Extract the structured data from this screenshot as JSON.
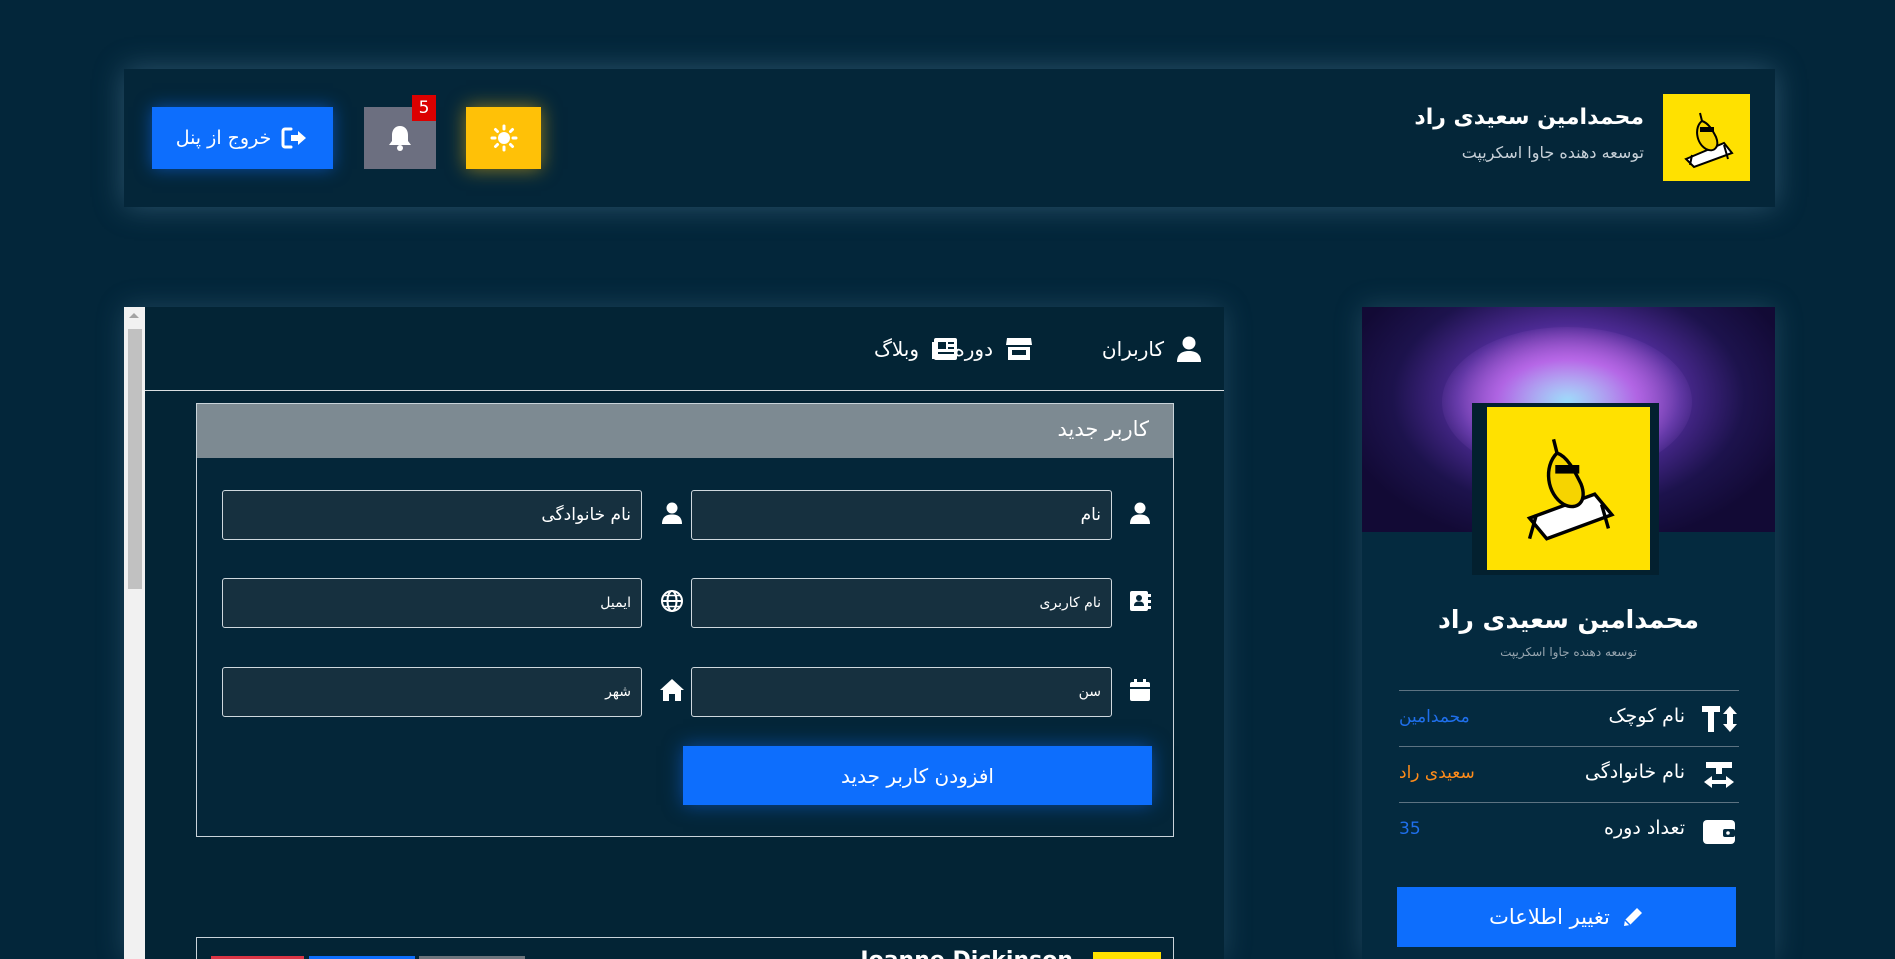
{
  "header": {
    "user_name": "محمدامین سعیدی راد",
    "user_role": "توسعه دهنده جاوا اسکریپت",
    "logout_label": "خروج از پنل",
    "notification_count": "5"
  },
  "nav": {
    "users": "کاربران",
    "courses": "دوره‌ها",
    "blog": "وبلاگ"
  },
  "new_user_form": {
    "title": "کاربر جدید",
    "first_name_value": "نام",
    "last_name_value": "نام خانوادگی",
    "username_value": "نام کاربری",
    "email_value": "ایمیل",
    "age_value": "سن",
    "city_value": "شهر",
    "submit_label": "افزودن کاربر جدید"
  },
  "user_list": {
    "first_user_name": "Joanne Dickinson"
  },
  "profile": {
    "name": "محمدامین سعیدی راد",
    "role": "توسعه دهنده جاوا اسکریپت",
    "rows": [
      {
        "label": "نام کوچک",
        "value": "محمدامین",
        "value_color": "#1f6feb"
      },
      {
        "label": "نام خانوادگی",
        "value": "سعیدی راد",
        "value_color": "#ff8c1a"
      },
      {
        "label": "تعداد دوره",
        "value": "35",
        "value_color": "#1f6feb"
      }
    ],
    "edit_label": "تغییر اطلاعات"
  },
  "colors": {
    "background": "#03263a",
    "primary": "#0d6efd",
    "warning": "#ffc107",
    "avatar_yellow": "#ffe100",
    "danger": "#dc0000"
  },
  "icons": {
    "logout": "logout-icon",
    "bell": "bell-icon",
    "theme": "sun-icon",
    "users": "user-icon",
    "courses": "store-icon",
    "blog": "newspaper-icon"
  }
}
